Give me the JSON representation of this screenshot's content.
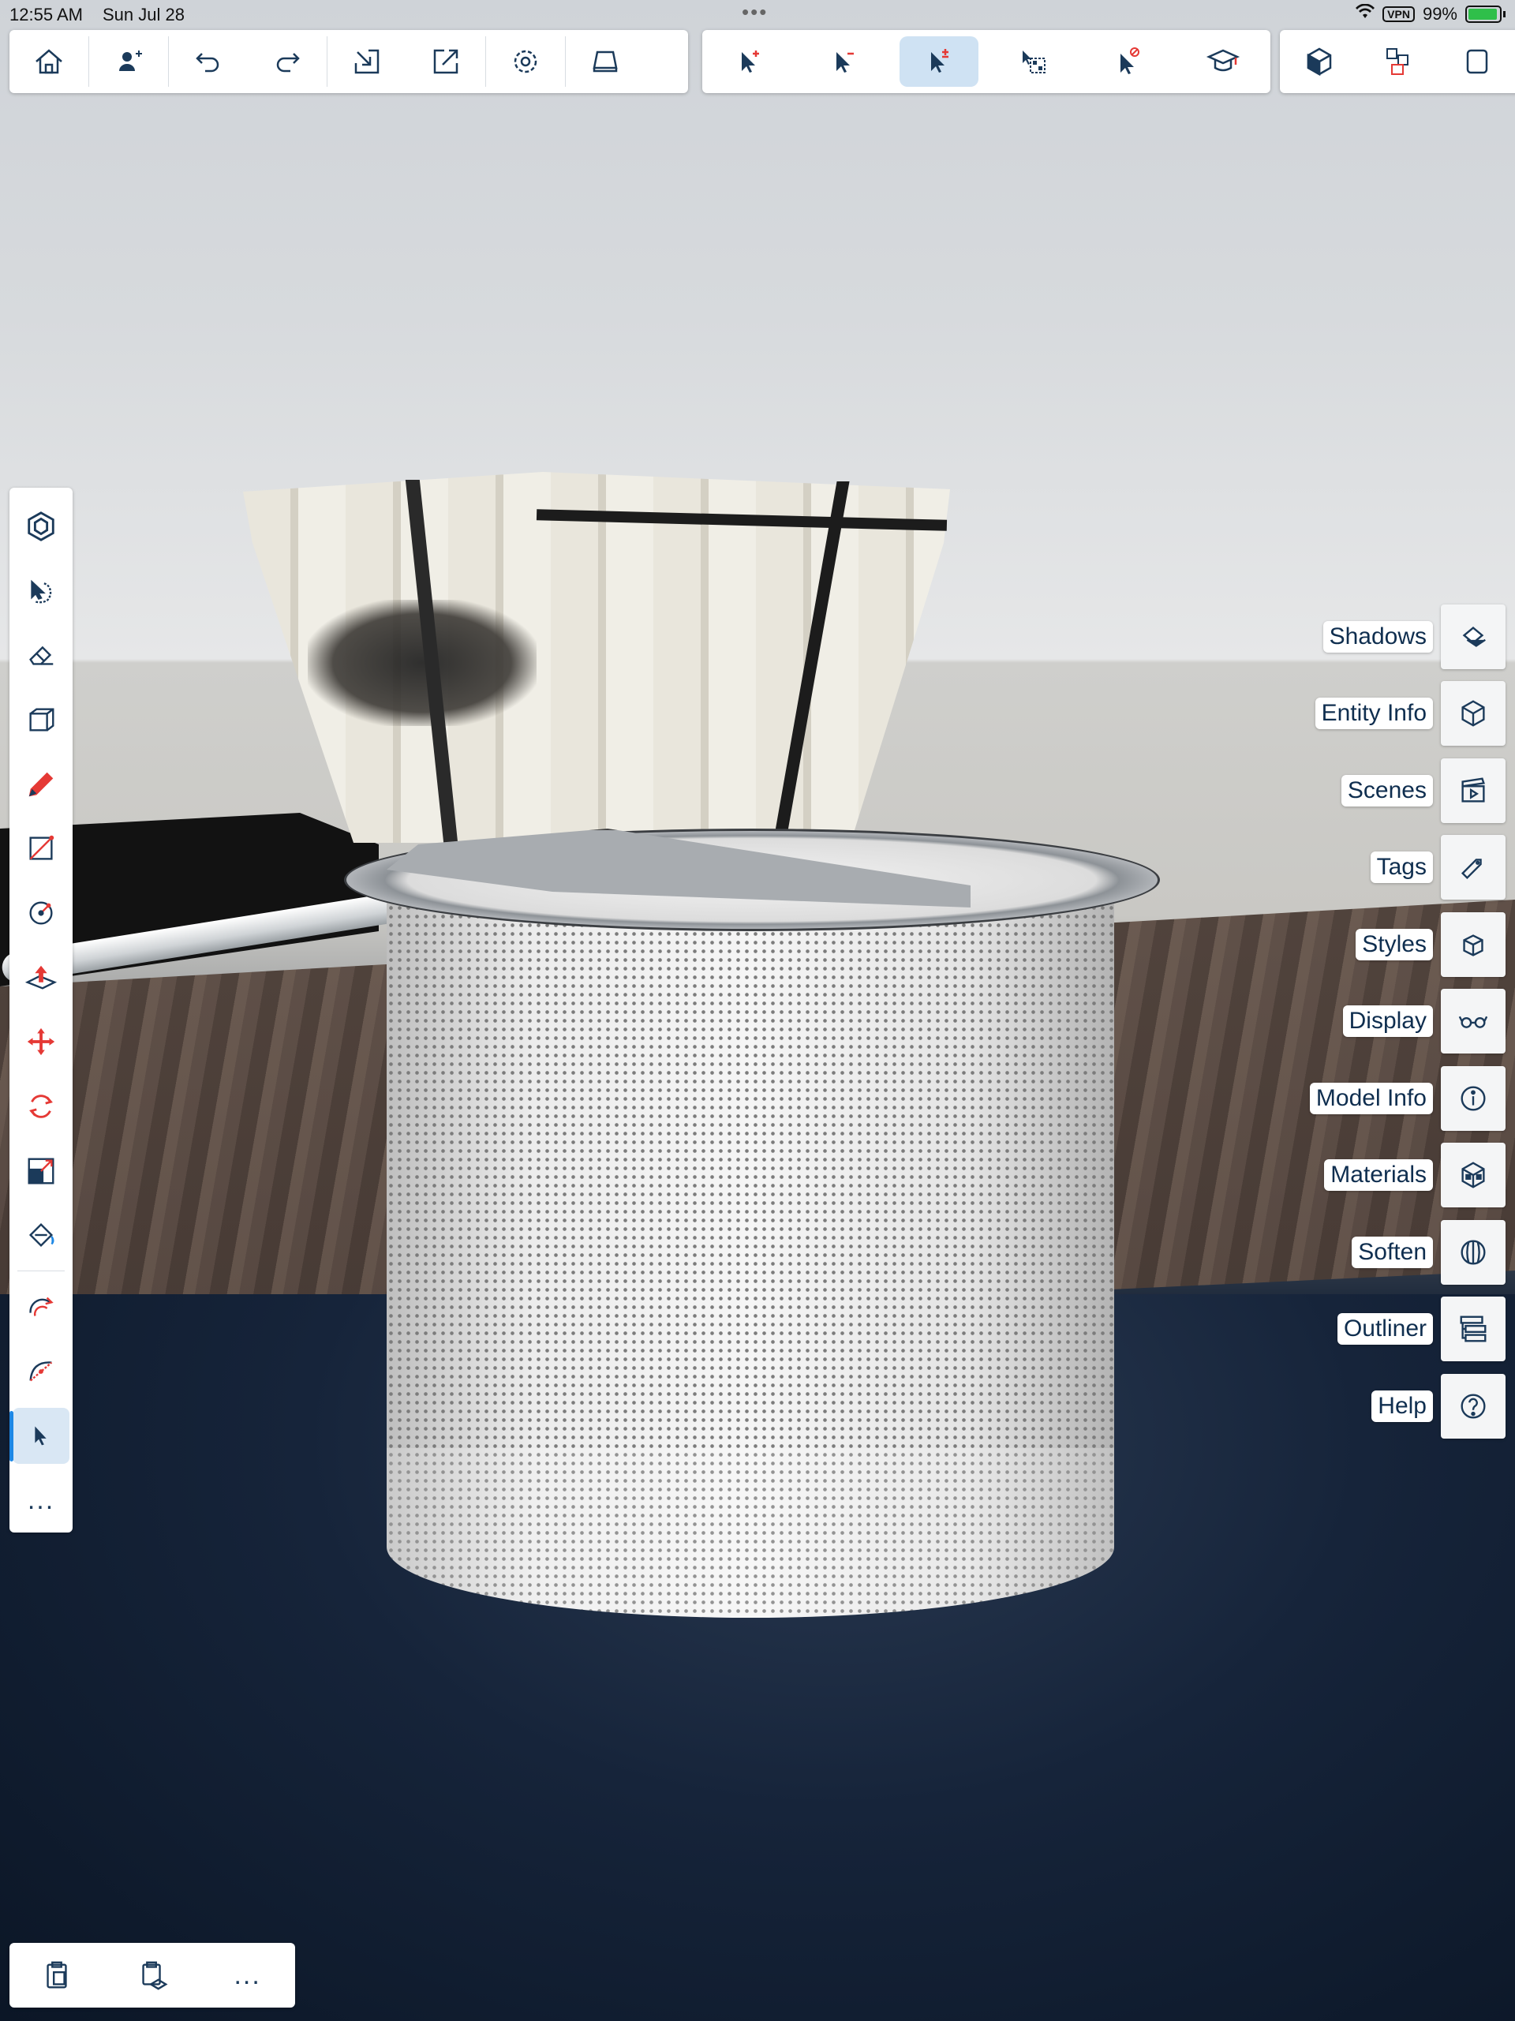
{
  "status_bar": {
    "time": "12:55 AM",
    "date": "Sun Jul 28",
    "grabber": "•••",
    "vpn": "VPN",
    "battery": "99%"
  },
  "top_toolbar": {
    "group1": [
      "home-icon",
      "add-person-icon",
      "undo-icon",
      "redo-icon",
      "import-icon",
      "export-icon",
      "settings-icon",
      "tray-icon"
    ],
    "group2": [
      "select-add-icon",
      "select-subtract-icon",
      "select-toggle-icon",
      "select-inside-icon",
      "select-exclude-icon",
      "tutorial-icon"
    ],
    "group3": [
      "component-icon",
      "components-browser-icon",
      "warehouse-icon"
    ],
    "active_tool": "select-toggle-icon"
  },
  "left_toolbar": {
    "tools": [
      "component-icon",
      "orbit-icon",
      "eraser-icon",
      "box-icon",
      "pencil-icon",
      "rectangle-icon",
      "circle-icon",
      "push-pull-icon",
      "move-icon",
      "rotate-icon",
      "scale-icon",
      "paint-bucket-icon",
      "follow-me-icon",
      "arc-icon",
      "select-icon"
    ],
    "active_tool": "select-icon",
    "more_label": "..."
  },
  "right_panel": {
    "items": [
      {
        "label": "Shadows",
        "icon": "shadows-icon"
      },
      {
        "label": "Entity Info",
        "icon": "entity-info-icon"
      },
      {
        "label": "Scenes",
        "icon": "scenes-icon"
      },
      {
        "label": "Tags",
        "icon": "tags-icon"
      },
      {
        "label": "Styles",
        "icon": "styles-icon"
      },
      {
        "label": "Display",
        "icon": "display-icon"
      },
      {
        "label": "Model Info",
        "icon": "model-info-icon"
      },
      {
        "label": "Materials",
        "icon": "materials-icon"
      },
      {
        "label": "Soften",
        "icon": "soften-icon"
      },
      {
        "label": "Outliner",
        "icon": "outliner-icon"
      },
      {
        "label": "Help",
        "icon": "help-icon"
      }
    ]
  },
  "bottom_toolbar": {
    "items": [
      "paste-icon",
      "clipboard-icon"
    ],
    "more_label": "..."
  },
  "colors": {
    "accent": "#1e88e5",
    "icon": "#1b3a5a",
    "active_bg": "#cfe2f3"
  }
}
